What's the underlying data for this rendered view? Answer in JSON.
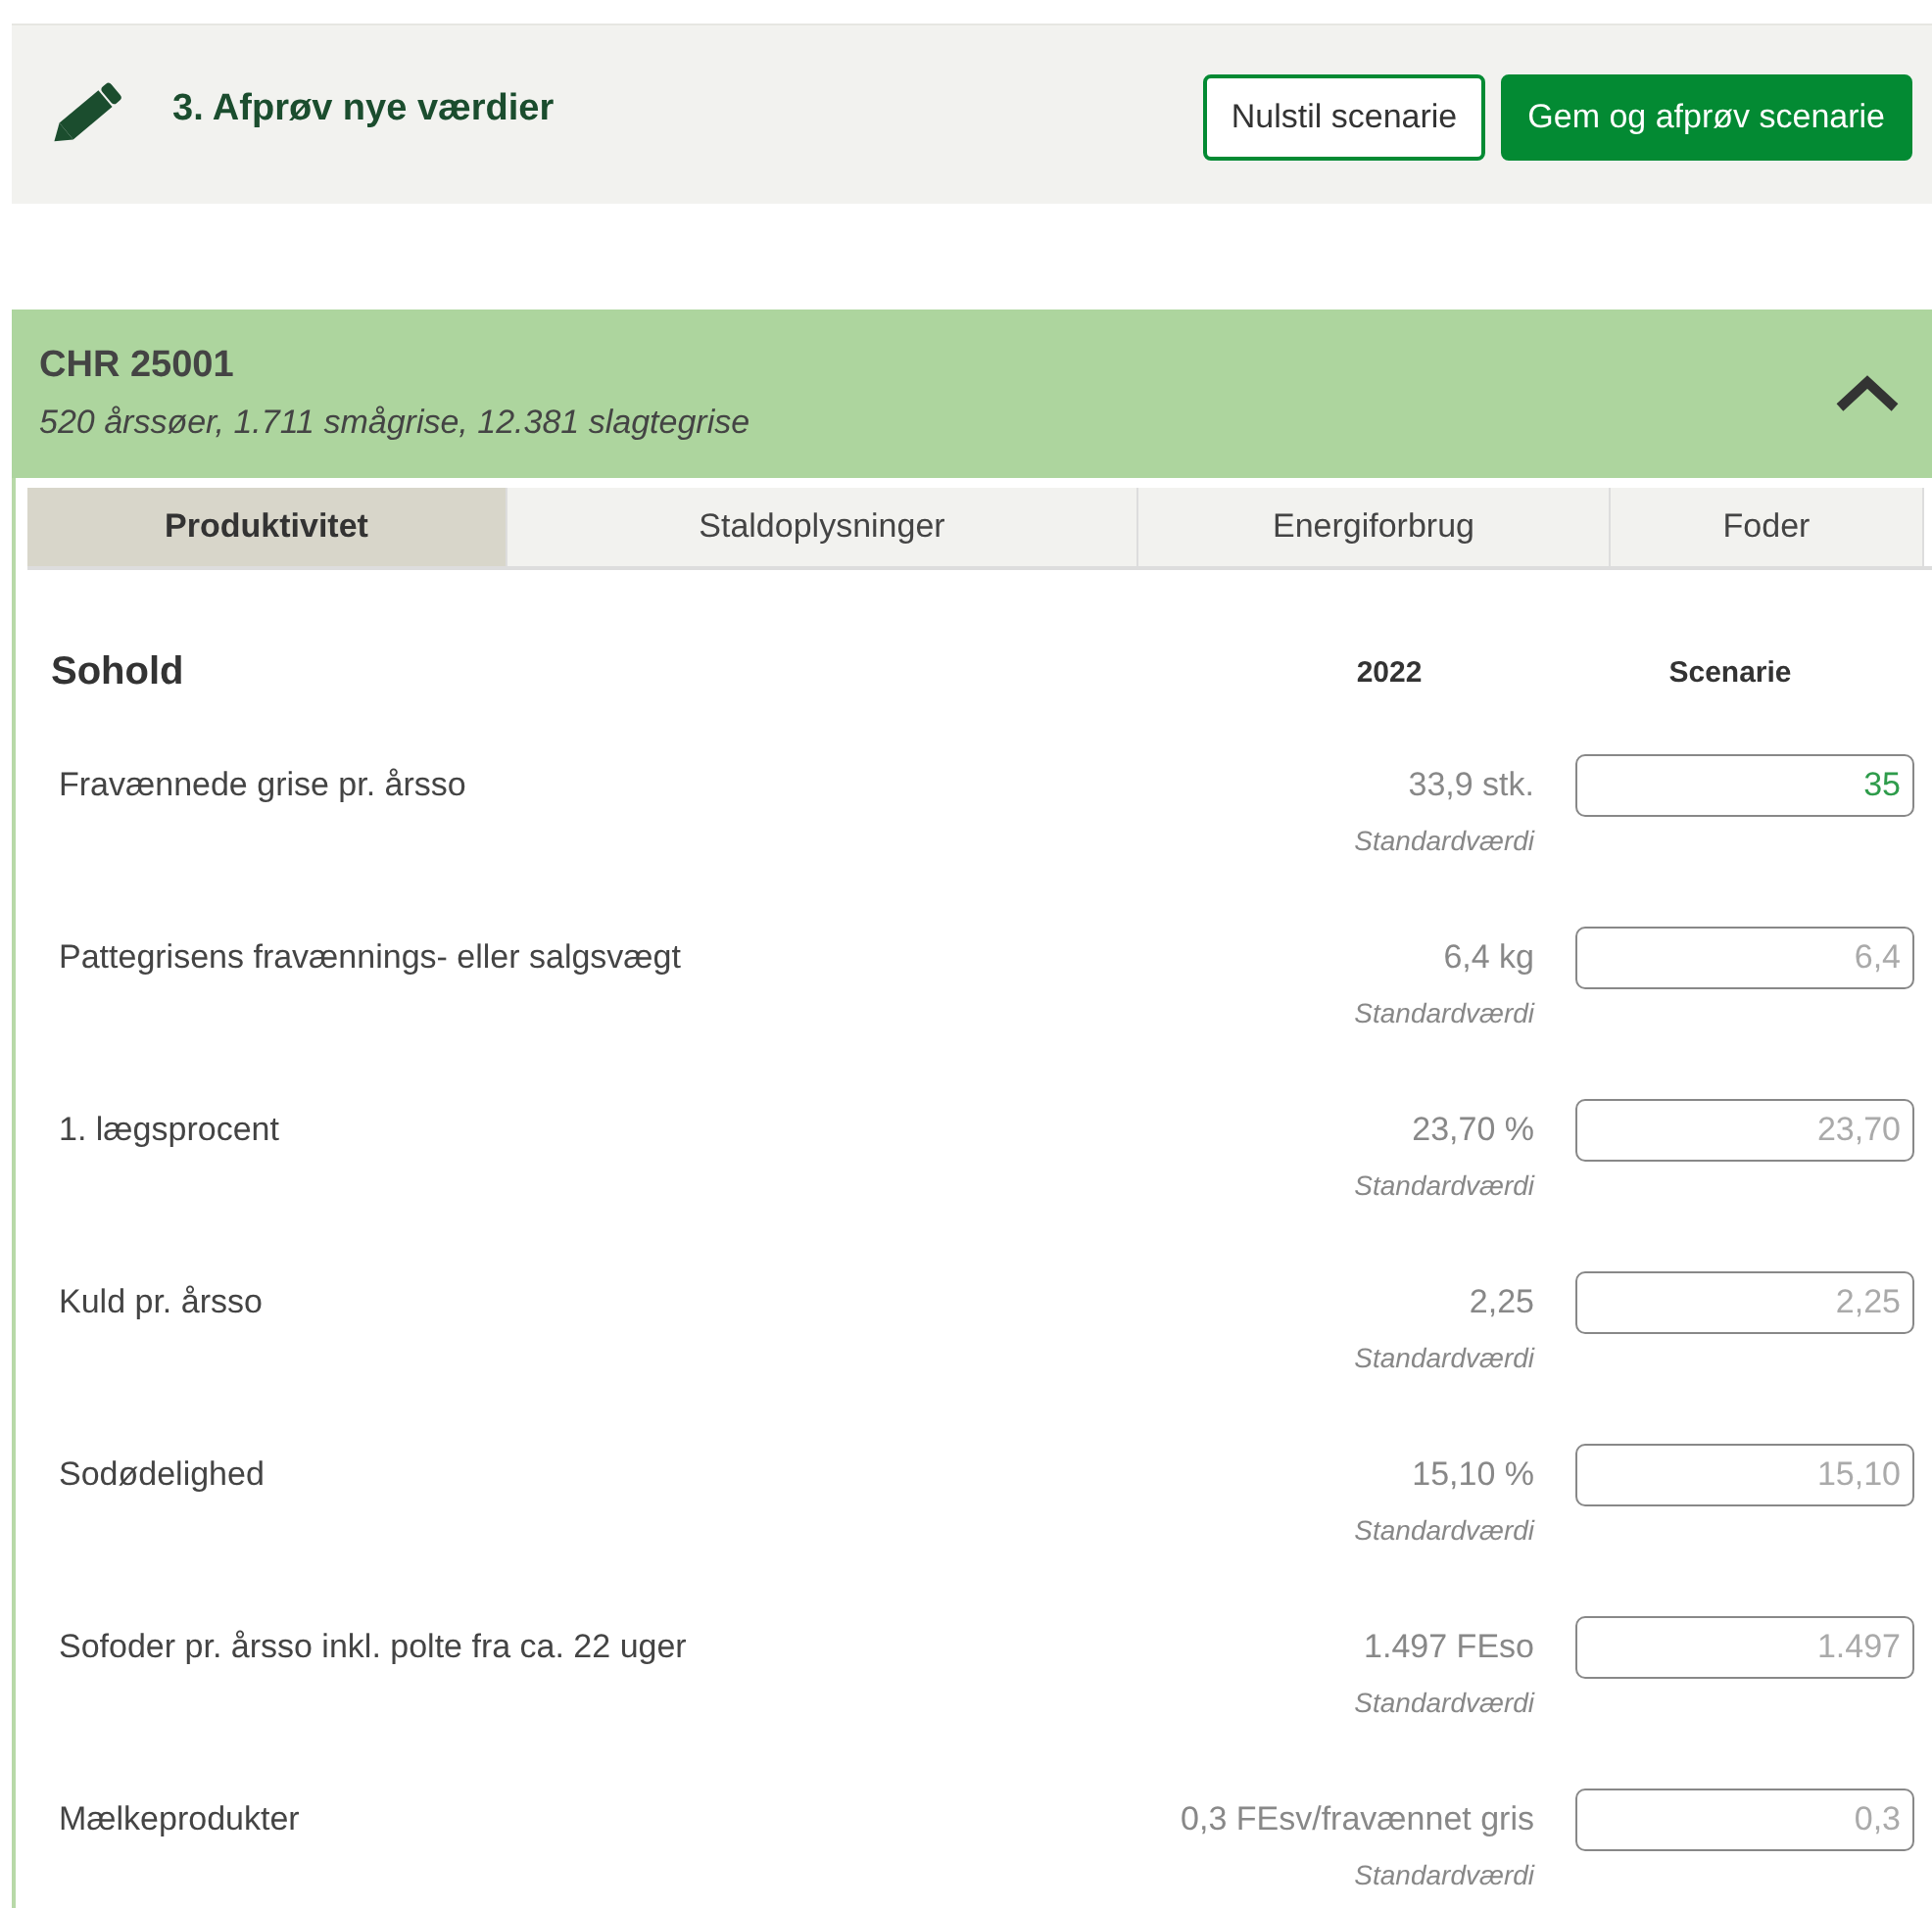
{
  "header": {
    "title": "3. Afprøv nye værdier",
    "buttons": [
      {
        "label": "Nulstil scenarie",
        "kind": "outline"
      },
      {
        "label": "Gem og afprøv scenarie",
        "kind": "primary"
      }
    ]
  },
  "farm": {
    "title": "CHR 25001",
    "subtitle": "520 årssøer, 1.711 smågrise, 12.381 slagtegrise",
    "expanded": true
  },
  "tabs": [
    {
      "label": "Produktivitet",
      "selected": true
    },
    {
      "label": "Staldoplysninger",
      "selected": false
    },
    {
      "label": "Energiforbrug",
      "selected": false
    },
    {
      "label": "Foder",
      "selected": false
    }
  ],
  "table": {
    "section": "Sohold",
    "year_heading": "2022",
    "scenario_heading": "Scenarie",
    "rows": [
      {
        "label": "Fravænnede grise pr. årsso",
        "current": "33,9 stk.",
        "note": "Standardværdi",
        "value": "35"
      },
      {
        "label": "Pattegrisens fravænnings- eller salgsvægt",
        "current": "6,4 kg",
        "note": "Standardværdi",
        "placeholder": "6,4"
      },
      {
        "label": "1. lægsprocent",
        "current": "23,70 %",
        "note": "Standardværdi",
        "placeholder": "23,70"
      },
      {
        "label": "Kuld pr. årsso",
        "current": "2,25",
        "note": "Standardværdi",
        "placeholder": "2,25"
      },
      {
        "label": "Sodødelighed",
        "current": "15,10 %",
        "note": "Standardværdi",
        "placeholder": "15,10"
      },
      {
        "label": "Sofoder pr. årsso inkl. polte fra ca. 22 uger",
        "current": "1.497 FEso",
        "note": "Standardværdi",
        "placeholder": "1.497"
      },
      {
        "label": "Mælkeprodukter",
        "current": "0,3 FEsv/fravænnet gris",
        "note": "Standardværdi",
        "placeholder": "0,3"
      }
    ]
  }
}
